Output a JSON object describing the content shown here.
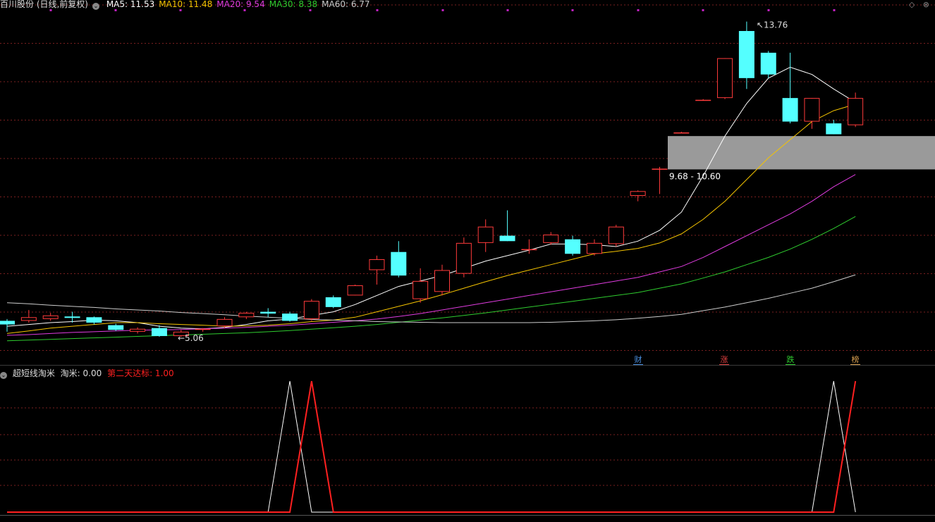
{
  "header": {
    "stock_title": "百川股份 (日线,前复权)",
    "ma_indicators": [
      {
        "label": "MA5: 11.53",
        "color": "#ffffff"
      },
      {
        "label": "MA10: 11.48",
        "color": "#f5c400"
      },
      {
        "label": "MA20: 9.54",
        "color": "#e03ce0"
      },
      {
        "label": "MA30: 8.38",
        "color": "#2fcc2f"
      },
      {
        "label": "MA60: 6.77",
        "color": "#cccccc"
      }
    ],
    "window_controls": "◇ ⊗"
  },
  "price_labels": {
    "high": "13.76",
    "low": "5.06",
    "zone": "9.68 - 10.60"
  },
  "event_markers": [
    {
      "text": "财",
      "color": "#4a90e2"
    },
    {
      "text": "涨",
      "color": "#e04040"
    },
    {
      "text": "跌",
      "color": "#30cc30"
    },
    {
      "text": "榜",
      "color": "#d8a050"
    }
  ],
  "sub_indicator": {
    "name": "超短线淘米",
    "value_label": "淘米: 0.00",
    "value2_label": "第二天达标: 1.00",
    "value2_color": "#ff2020"
  },
  "colors": {
    "up": "#ff3b3b",
    "down": "#54ffff",
    "grid": "#7a1f1f",
    "marker": "#c020c0",
    "zone": "#9a9a9a"
  },
  "chart_data": {
    "type": "candlestick",
    "ylim": [
      4.4,
      14.2
    ],
    "candles": [
      {
        "o": 5.5,
        "h": 5.55,
        "l": 5.2,
        "c": 5.4
      },
      {
        "o": 5.5,
        "h": 5.8,
        "l": 5.45,
        "c": 5.6
      },
      {
        "o": 5.55,
        "h": 5.72,
        "l": 5.5,
        "c": 5.65
      },
      {
        "o": 5.62,
        "h": 5.75,
        "l": 5.45,
        "c": 5.58
      },
      {
        "o": 5.6,
        "h": 5.62,
        "l": 5.4,
        "c": 5.45
      },
      {
        "o": 5.38,
        "h": 5.42,
        "l": 5.22,
        "c": 5.25
      },
      {
        "o": 5.2,
        "h": 5.32,
        "l": 5.15,
        "c": 5.28
      },
      {
        "o": 5.3,
        "h": 5.38,
        "l": 5.06,
        "c": 5.08
      },
      {
        "o": 5.08,
        "h": 5.25,
        "l": 5.06,
        "c": 5.2
      },
      {
        "o": 5.25,
        "h": 5.3,
        "l": 5.2,
        "c": 5.28
      },
      {
        "o": 5.35,
        "h": 5.6,
        "l": 5.3,
        "c": 5.55
      },
      {
        "o": 5.6,
        "h": 5.75,
        "l": 5.55,
        "c": 5.72
      },
      {
        "o": 5.75,
        "h": 5.85,
        "l": 5.6,
        "c": 5.7
      },
      {
        "o": 5.7,
        "h": 5.75,
        "l": 5.48,
        "c": 5.5
      },
      {
        "o": 5.55,
        "h": 6.1,
        "l": 5.5,
        "c": 6.05
      },
      {
        "o": 6.15,
        "h": 6.2,
        "l": 5.85,
        "c": 5.88
      },
      {
        "o": 6.2,
        "h": 6.5,
        "l": 6.2,
        "c": 6.48
      },
      {
        "o": 6.9,
        "h": 7.3,
        "l": 6.5,
        "c": 7.2
      },
      {
        "o": 7.4,
        "h": 7.7,
        "l": 6.7,
        "c": 6.75
      },
      {
        "o": 6.1,
        "h": 6.95,
        "l": 6.0,
        "c": 6.6
      },
      {
        "o": 6.3,
        "h": 7.05,
        "l": 6.2,
        "c": 6.9
      },
      {
        "o": 6.8,
        "h": 7.8,
        "l": 6.7,
        "c": 7.65
      },
      {
        "o": 7.65,
        "h": 8.3,
        "l": 7.4,
        "c": 8.1
      },
      {
        "o": 7.85,
        "h": 8.55,
        "l": 7.7,
        "c": 7.7
      },
      {
        "o": 7.45,
        "h": 7.75,
        "l": 7.35,
        "c": 7.48
      },
      {
        "o": 7.65,
        "h": 7.95,
        "l": 7.6,
        "c": 7.88
      },
      {
        "o": 7.75,
        "h": 7.85,
        "l": 7.3,
        "c": 7.35
      },
      {
        "o": 7.35,
        "h": 7.75,
        "l": 7.3,
        "c": 7.65
      },
      {
        "o": 7.62,
        "h": 8.15,
        "l": 7.55,
        "c": 8.1
      },
      {
        "o": 8.95,
        "h": 9.1,
        "l": 8.8,
        "c": 9.08
      },
      {
        "o": 9.7,
        "h": 9.75,
        "l": 9.0,
        "c": 9.7
      },
      {
        "o": 10.7,
        "h": 10.72,
        "l": 10.68,
        "c": 10.7
      },
      {
        "o": 11.6,
        "h": 11.62,
        "l": 11.58,
        "c": 11.6
      },
      {
        "o": 11.65,
        "h": 12.75,
        "l": 11.62,
        "c": 12.75
      },
      {
        "o": 13.5,
        "h": 13.76,
        "l": 11.9,
        "c": 12.2
      },
      {
        "o": 12.9,
        "h": 12.95,
        "l": 12.2,
        "c": 12.3
      },
      {
        "o": 11.65,
        "h": 12.9,
        "l": 10.95,
        "c": 11.0
      },
      {
        "o": 11.0,
        "h": 11.65,
        "l": 10.8,
        "c": 11.65
      },
      {
        "o": 10.95,
        "h": 11.05,
        "l": 10.65,
        "c": 10.65
      },
      {
        "o": 10.9,
        "h": 11.8,
        "l": 10.85,
        "c": 11.65
      }
    ],
    "ma_series": [
      {
        "name": "MA5",
        "color": "#ffffff",
        "values": [
          5.35,
          5.4,
          5.45,
          5.48,
          5.52,
          5.5,
          5.45,
          5.35,
          5.3,
          5.28,
          5.32,
          5.4,
          5.5,
          5.55,
          5.65,
          5.75,
          5.95,
          6.2,
          6.45,
          6.6,
          6.75,
          6.95,
          7.15,
          7.3,
          7.45,
          7.62,
          7.62,
          7.6,
          7.55,
          7.7,
          8.0,
          8.5,
          9.5,
          10.6,
          11.5,
          12.2,
          12.5,
          12.3,
          11.9,
          11.53
        ]
      },
      {
        "name": "MA10",
        "color": "#f5c400",
        "values": [
          5.15,
          5.22,
          5.3,
          5.35,
          5.4,
          5.45,
          5.45,
          5.42,
          5.4,
          5.38,
          5.35,
          5.36,
          5.38,
          5.42,
          5.48,
          5.52,
          5.6,
          5.75,
          5.9,
          6.05,
          6.22,
          6.4,
          6.58,
          6.75,
          6.9,
          7.05,
          7.2,
          7.35,
          7.42,
          7.5,
          7.65,
          7.9,
          8.3,
          8.8,
          9.4,
          10.0,
          10.5,
          11.0,
          11.3,
          11.48
        ]
      },
      {
        "name": "MA20",
        "color": "#e03ce0",
        "values": [
          5.1,
          5.12,
          5.15,
          5.18,
          5.2,
          5.22,
          5.24,
          5.25,
          5.26,
          5.28,
          5.3,
          5.32,
          5.35,
          5.38,
          5.42,
          5.46,
          5.5,
          5.55,
          5.62,
          5.7,
          5.8,
          5.9,
          6.0,
          6.1,
          6.2,
          6.3,
          6.4,
          6.5,
          6.6,
          6.7,
          6.85,
          7.0,
          7.25,
          7.55,
          7.85,
          8.15,
          8.45,
          8.8,
          9.2,
          9.54
        ]
      },
      {
        "name": "MA30",
        "color": "#2fcc2f",
        "values": [
          4.95,
          4.97,
          4.99,
          5.01,
          5.03,
          5.05,
          5.07,
          5.09,
          5.11,
          5.13,
          5.15,
          5.17,
          5.2,
          5.23,
          5.27,
          5.31,
          5.35,
          5.4,
          5.46,
          5.52,
          5.58,
          5.65,
          5.72,
          5.8,
          5.88,
          5.96,
          6.04,
          6.12,
          6.2,
          6.28,
          6.4,
          6.52,
          6.68,
          6.85,
          7.05,
          7.25,
          7.48,
          7.75,
          8.05,
          8.38
        ]
      },
      {
        "name": "MA60",
        "color": "#cccccc",
        "values": [
          6.0,
          5.97,
          5.93,
          5.9,
          5.87,
          5.83,
          5.8,
          5.77,
          5.73,
          5.7,
          5.67,
          5.63,
          5.6,
          5.57,
          5.54,
          5.52,
          5.5,
          5.48,
          5.47,
          5.46,
          5.45,
          5.45,
          5.45,
          5.45,
          5.45,
          5.46,
          5.48,
          5.5,
          5.53,
          5.57,
          5.62,
          5.68,
          5.78,
          5.88,
          6.0,
          6.12,
          6.26,
          6.4,
          6.58,
          6.77
        ]
      }
    ],
    "zone": {
      "low": 9.68,
      "high": 10.6
    },
    "sub": {
      "white": [
        {
          "i": 0,
          "v": 0
        },
        {
          "i": 12,
          "v": 0
        },
        {
          "i": 13,
          "v": 1
        },
        {
          "i": 14,
          "v": 0
        },
        {
          "i": 37,
          "v": 0
        },
        {
          "i": 38,
          "v": 1
        },
        {
          "i": 39,
          "v": 0
        }
      ],
      "red": [
        {
          "i": 0,
          "v": 0
        },
        {
          "i": 13,
          "v": 0
        },
        {
          "i": 14,
          "v": 1
        },
        {
          "i": 15,
          "v": 0
        },
        {
          "i": 38,
          "v": 0
        },
        {
          "i": 39,
          "v": 1
        }
      ]
    }
  }
}
